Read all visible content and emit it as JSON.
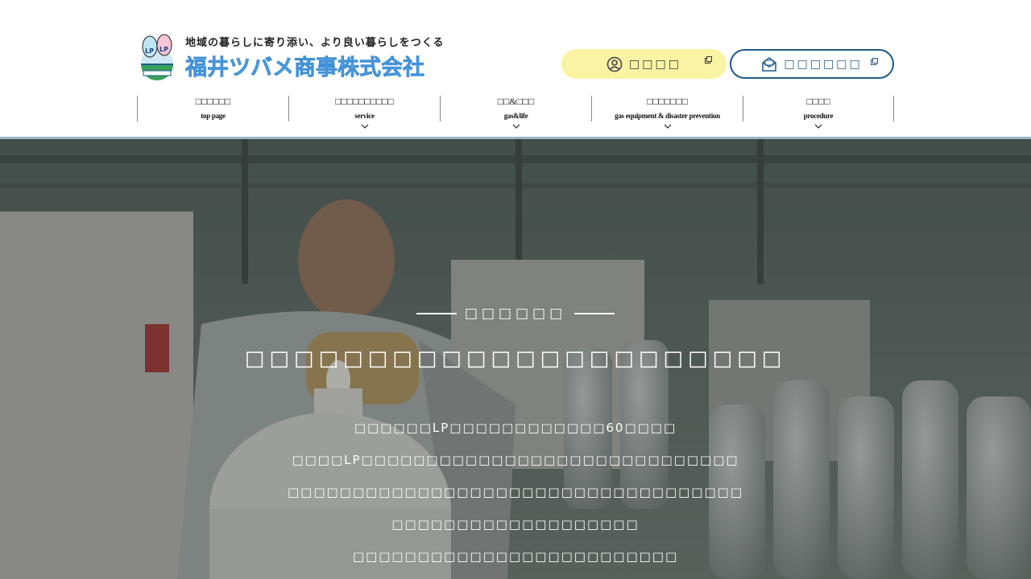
{
  "header": {
    "tagline": "地域の暮らしに寄り添い、より良い暮らしをつくる",
    "company_name": "福井ツバメ商事株式会社",
    "emblem_text": "LP",
    "inquiry_button": "□□□□",
    "contact_button": "□□□□□□"
  },
  "nav": {
    "items": [
      {
        "jp": "□□□□□□",
        "en": "top page",
        "has_dropdown": false
      },
      {
        "jp": "□□□□□□□□□□",
        "en": "service",
        "has_dropdown": true
      },
      {
        "jp": "□□&□□□",
        "en": "gas&life",
        "has_dropdown": true
      },
      {
        "jp": "□□□□□□□",
        "en": "gas equipment & disaster prevention",
        "has_dropdown": true
      },
      {
        "jp": "□□□□",
        "en": "procedure",
        "has_dropdown": true
      }
    ]
  },
  "hero": {
    "label": "□□□□□□",
    "title": "□□□□□□□□□□□□□□□□□□□□□□",
    "paragraphs": [
      "□□□□□□LP□□□□□□□□□□□□60□□□□",
      "□□□□LP□□□□□□□□□□□□□□□□□□□□□□□□□□□□□",
      "□□□□□□□□□□□□□□□□□□□□□□□□□□□□□□□□□□□",
      "□□□□□□□□□□□□□□□□□□□",
      "□□□□□□□□□□□□□□□□□□□□□□□□□"
    ]
  },
  "colors": {
    "inquiry_bg": "#fbf3a4",
    "contact_border": "#1f5a86",
    "brand_blue": "#5ea6e4",
    "header_line": "#9bb5cc"
  }
}
